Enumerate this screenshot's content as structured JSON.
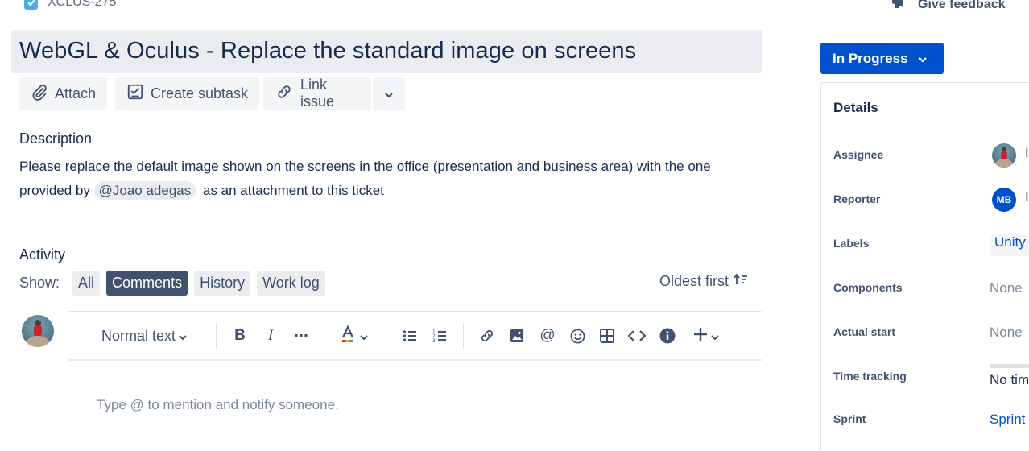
{
  "issue": {
    "key": "XCLUS-275",
    "title": "WebGL & Oculus - Replace the standard image on screens"
  },
  "header": {
    "give_feedback": "Give feedback"
  },
  "actions": {
    "attach": "Attach",
    "create_subtask": "Create subtask",
    "link_issue": "Link issue"
  },
  "description": {
    "label": "Description",
    "text_before": "Please replace the default image shown on the screens in the office (presentation and business area) with the one provided by",
    "mention": "@Joao adegas",
    "text_after": "as an attachment to this ticket"
  },
  "activity": {
    "label": "Activity",
    "show_label": "Show:",
    "filters": [
      "All",
      "Comments",
      "History",
      "Work log"
    ],
    "active_filter": "Comments",
    "sort": "Oldest first"
  },
  "editor": {
    "text_style": "Normal text",
    "placeholder": "Type @ to mention and notify someone."
  },
  "status": {
    "label": "In Progress",
    "color": "#0052cc"
  },
  "details": {
    "title": "Details",
    "fields": [
      {
        "label": "Assignee",
        "value": ""
      },
      {
        "label": "Reporter",
        "value": "MB"
      },
      {
        "label": "Labels",
        "value": "Unity"
      },
      {
        "label": "Components",
        "value": "None"
      },
      {
        "label": "Actual start",
        "value": "None"
      },
      {
        "label": "Time tracking",
        "value": "No tim"
      },
      {
        "label": "Sprint",
        "value": "Sprint"
      }
    ]
  },
  "icons": {
    "checkbox": "checkbox-icon",
    "megaphone": "megaphone-icon",
    "paperclip": "paperclip-icon",
    "subtask": "subtask-icon",
    "link": "link-icon",
    "chevron": "chevron-down-icon"
  },
  "colors": {
    "primary": "#0052cc",
    "text": "#172b4d",
    "subtle": "#42526e",
    "chip_bg": "#ebecf0",
    "chip_active": "#42526e"
  }
}
